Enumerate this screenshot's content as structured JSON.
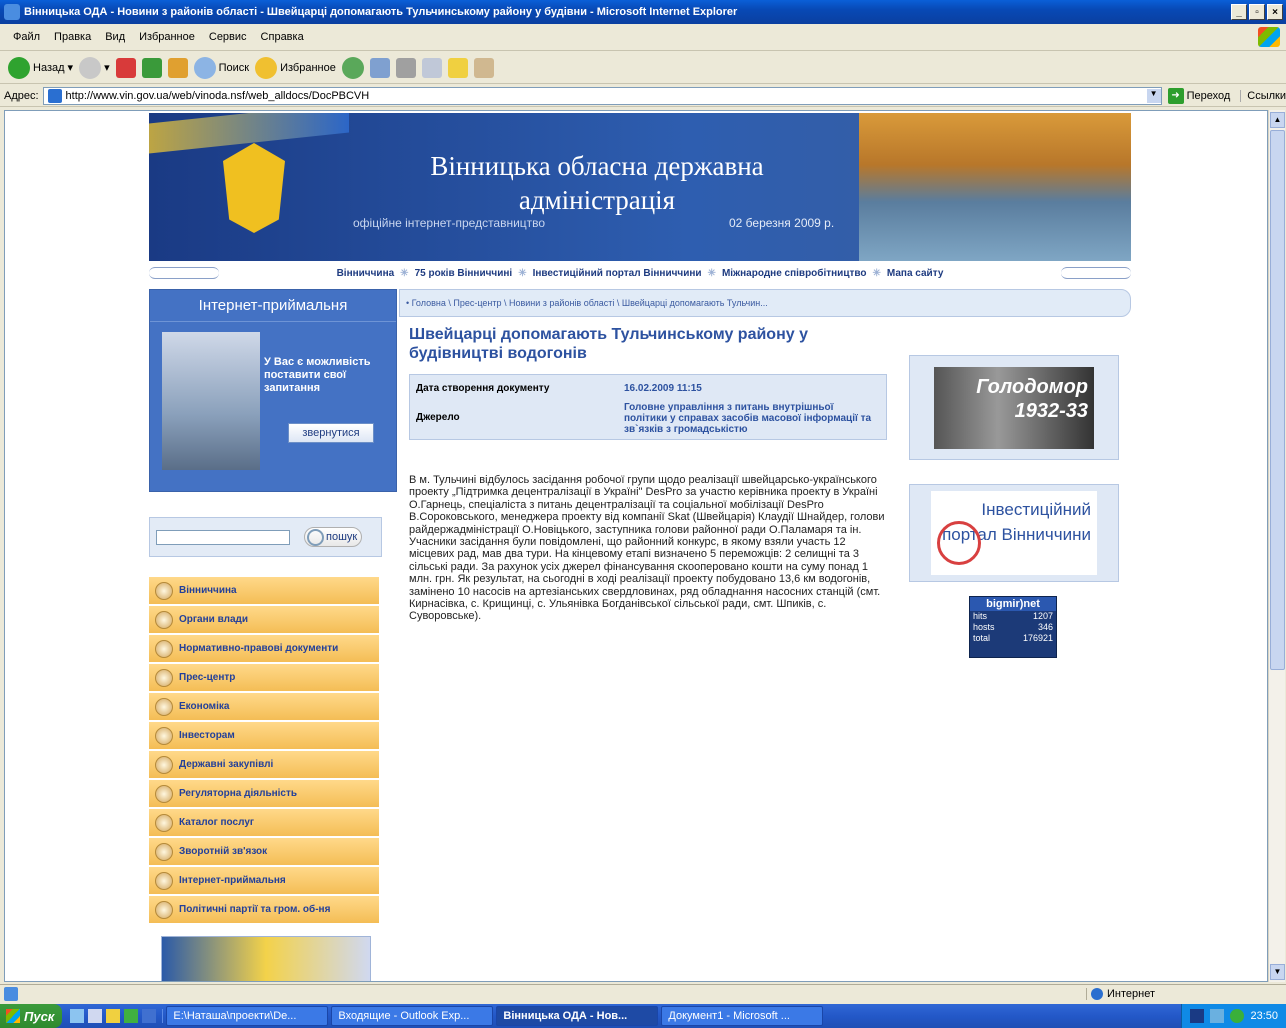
{
  "window": {
    "title": "Вінницька ОДА - Новини з районів області - Швейцарці допомагають Тульчинському району у будівни - Microsoft Internet Explorer"
  },
  "menubar": [
    "Файл",
    "Правка",
    "Вид",
    "Избранное",
    "Сервис",
    "Справка"
  ],
  "toolbar": {
    "back": "Назад",
    "search": "Поиск",
    "favorites": "Избранное"
  },
  "address": {
    "label": "Адрес:",
    "url": "http://www.vin.gov.ua/web/vinoda.nsf/web_alldocs/DocPBCVH",
    "go": "Переход",
    "links": "Ссылки"
  },
  "banner": {
    "title": "Вінницька обласна державна адміністрація",
    "subtitle": "офіційне інтернет-представництво",
    "date": "02 березня 2009 р."
  },
  "topnav": [
    "Вінниччина",
    "75 років Вінниччині",
    "Інвестиційний портал Вінниччини",
    "Міжнародне співробітництво",
    "Мапа сайту"
  ],
  "reception": {
    "title": "Інтернет-приймальня",
    "text": "У Вас є можливість поставити свої запитання",
    "button": "звернутися"
  },
  "search": {
    "button": "пошук"
  },
  "left_menu": [
    "Вінниччина",
    "Органи влади",
    "Нормативно-правові документи",
    "Прес-центр",
    "Економіка",
    "Інвесторам",
    "Державні закупівлі",
    "Регуляторна діяльність",
    "Каталог послуг",
    "Зворотній зв'язок",
    "Інтернет-приймальня",
    "Політичні партії та гром. об-ня"
  ],
  "breadcrumb": "• Головна \\ Прес-центр \\ Новини з районів області \\ Швейцарці допомагають Тульчин...",
  "article": {
    "title": "Швейцарці допомагають Тульчинському району у будівництві водогонів",
    "date_label": "Дата створення документу",
    "date_value": "16.02.2009   11:15",
    "source_label": "Джерело",
    "source_value": "Головне управління з питань внутрішньої політики у справах засобів масової інформації та зв`язків з громадськістю",
    "body": "В м. Тульчині відбулось засідання робочої групи щодо реалізації швейцарсько-українського проекту „Підтримка децентралізації в Україні\" DesPro за участю керівника проекту в Україні О.Гарнець, спеціаліста з питань децентралізації та соціальної мобілізації DesPro В.Сороковського, менеджера проекту від компанії Skat (Швейцарія) Клаудії Шнайдер, голови райдержадміністрації О.Новіцького, заступника голови районної ради О.Паламаря та ін.",
    "body2": "Учасники засідання були повідомлені, що районний конкурс, в якому взяли участь 12 місцевих рад, мав два тури. На кінцевому етапі визначено 5 переможців: 2 селищні та 3 сільські ради. За рахунок усіх джерел фінансування скооперовано кошти на суму понад 1 млн. грн. Як результат, на сьогодні в ході реалізації проекту побудовано 13,6 км водогонів, замінено 10 насосів на артезіанських свердловинах, ряд обладнання насосних станцій (смт. Кирнасівка, с. Крищинці, с. Ульянівка Богданівської сільської ради, смт. Шпиків, с. Суворовське)."
  },
  "ads": {
    "holodomor": "Голодомор 1932-33",
    "portal": "Інвестиційний портал Вінниччини"
  },
  "counter": {
    "name": "bigmir)net",
    "hits_label": "hits",
    "hits": "1207",
    "hosts_label": "hosts",
    "hosts": "346",
    "total_label": "total",
    "total": "176921"
  },
  "status": {
    "zone": "Интернет"
  },
  "taskbar": {
    "start": "Пуск",
    "tasks": [
      "E:\\Наташа\\проекти\\De...",
      "Входящие - Outlook Exp...",
      "Вінницька ОДА - Нов...",
      "Документ1 - Microsoft ..."
    ],
    "clock": "23:50"
  }
}
